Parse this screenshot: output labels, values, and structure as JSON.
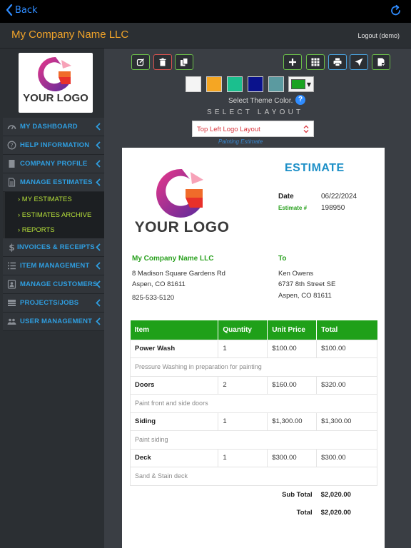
{
  "nav": {
    "back_label": "Back"
  },
  "header": {
    "company": "My Company Name LLC",
    "logout": "Logout (demo)"
  },
  "sidebar": {
    "logo_text": "YOUR LOGO",
    "items": [
      {
        "label": "MY DASHBOARD",
        "icon": "dashboard-icon"
      },
      {
        "label": "HELP INFORMATION",
        "icon": "help-icon"
      },
      {
        "label": "COMPANY PROFILE",
        "icon": "profile-icon"
      },
      {
        "label": "MANAGE ESTIMATES",
        "icon": "document-icon"
      }
    ],
    "subitems": [
      "› MY ESTIMATES",
      "› ESTIMATES ARCHIVE",
      "› REPORTS"
    ],
    "items2": [
      {
        "label": "INVOICES & RECEIPTS",
        "icon": "dollar-icon"
      },
      {
        "label": "ITEM MANAGEMENT",
        "icon": "list-icon"
      },
      {
        "label": "MANAGE CUSTOMERS",
        "icon": "contacts-icon"
      },
      {
        "label": "PROJECTS/JOBS",
        "icon": "projects-icon"
      },
      {
        "label": "USER MANAGEMENT",
        "icon": "users-icon"
      }
    ]
  },
  "toolbar": {
    "left_icons": [
      "edit-icon",
      "trash-icon",
      "copy-icon"
    ],
    "right_icons": [
      "add-icon",
      "grid-icon",
      "print-icon",
      "send-icon",
      "save-icon"
    ]
  },
  "theme": {
    "swatches": [
      "#f4f4f4",
      "#f5a623",
      "#1bbf8e",
      "#0a128c",
      "#5b9aa0"
    ],
    "selected": "#1aa321",
    "label": "Select Theme Color.",
    "help": "?",
    "layout_label": "SELECT LAYOUT",
    "layout_value": "Top Left Logo Layout",
    "doc_type": "Painting Estimate"
  },
  "estimate": {
    "title": "ESTIMATE",
    "logo_text": "YOUR LOGO",
    "date_label": "Date",
    "date_value": "06/22/2024",
    "number_label": "Estimate #",
    "number_value": "198950",
    "from": {
      "name": "My Company Name LLC",
      "line1": "8 Madison Square Gardens Rd",
      "line2": "Aspen, CO 81611",
      "phone": "825-533-5120"
    },
    "to": {
      "label": "To",
      "name": "Ken Owens",
      "line1": "6737 8th Street SE",
      "line2": "Aspen, CO 81611"
    },
    "columns": [
      "Item",
      "Quantity",
      "Unit Price",
      "Total"
    ],
    "items": [
      {
        "name": "Power Wash",
        "qty": "1",
        "price": "$100.00",
        "total": "$100.00",
        "desc": "Pressure Washing in preparation for painting"
      },
      {
        "name": "Doors",
        "qty": "2",
        "price": "$160.00",
        "total": "$320.00",
        "desc": "Paint front and side doors"
      },
      {
        "name": "Siding",
        "qty": "1",
        "price": "$1,300.00",
        "total": "$1,300.00",
        "desc": "Paint siding"
      },
      {
        "name": "Deck",
        "qty": "1",
        "price": "$300.00",
        "total": "$300.00",
        "desc": "Sand & Stain deck"
      }
    ],
    "subtotal_label": "Sub Total",
    "subtotal_value": "$2,020.00",
    "total_label": "Total",
    "total_value": "$2,020.00"
  }
}
